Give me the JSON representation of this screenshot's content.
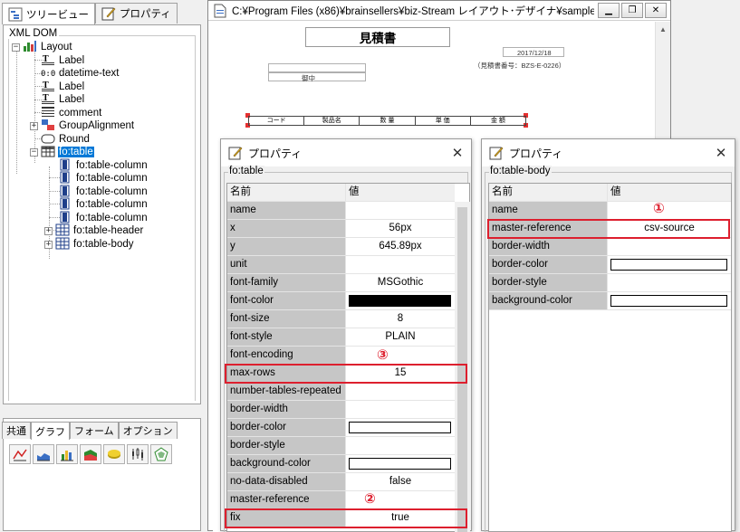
{
  "left_tabs": {
    "tree_label": "ツリービュー",
    "prop_label": "プロパティ"
  },
  "tree": {
    "legend": "XML DOM",
    "nodes": [
      {
        "label": "Layout"
      },
      {
        "label": "Label"
      },
      {
        "label": "datetime-text"
      },
      {
        "label": "Label"
      },
      {
        "label": "Label"
      },
      {
        "label": "comment"
      },
      {
        "label": "GroupAlignment"
      },
      {
        "label": "Round"
      },
      {
        "label": "fo:table"
      },
      {
        "label": "fo:table-column"
      },
      {
        "label": "fo:table-column"
      },
      {
        "label": "fo:table-column"
      },
      {
        "label": "fo:table-column"
      },
      {
        "label": "fo:table-column"
      },
      {
        "label": "fo:table-header"
      },
      {
        "label": "fo:table-body"
      }
    ]
  },
  "palette": {
    "tabs": [
      "共通",
      "グラフ",
      "フォーム",
      "オプション"
    ],
    "icons": [
      "line-chart-icon",
      "area-chart-icon",
      "bar-chart-icon",
      "stacked-area-icon",
      "pie-3d-icon",
      "candle-chart-icon",
      "radar-chart-icon"
    ]
  },
  "designer": {
    "title": "C:¥Program Files (x86)¥brainsellers¥biz-Stream レイアウト･デザイナ¥sample¥...",
    "doc_title": "見積書",
    "doc_date": "2017/12/18",
    "doc_number": "（見積書番号：BZS-E-0226）",
    "honorific": "御中",
    "table_headers": [
      "コード",
      "製品名",
      "数 量",
      "単 価",
      "金 額"
    ]
  },
  "dialog_left": {
    "title": "プロパティ",
    "legend": "fo:table",
    "header_name": "名前",
    "header_value": "値",
    "rows": [
      {
        "name": "name",
        "value": ""
      },
      {
        "name": "x",
        "value": "56px"
      },
      {
        "name": "y",
        "value": "645.89px"
      },
      {
        "name": "unit",
        "value": ""
      },
      {
        "name": "font-family",
        "value": "MSGothic"
      },
      {
        "name": "font-color",
        "value": ""
      },
      {
        "name": "font-size",
        "value": "8"
      },
      {
        "name": "font-style",
        "value": "PLAIN"
      },
      {
        "name": "font-encoding",
        "value": ""
      },
      {
        "name": "max-rows",
        "value": "15"
      },
      {
        "name": "number-tables-repeated",
        "value": ""
      },
      {
        "name": "border-width",
        "value": ""
      },
      {
        "name": "border-color",
        "value": ""
      },
      {
        "name": "border-style",
        "value": ""
      },
      {
        "name": "background-color",
        "value": ""
      },
      {
        "name": "no-data-disabled",
        "value": "false"
      },
      {
        "name": "master-reference",
        "value": ""
      },
      {
        "name": "fix",
        "value": "true"
      }
    ],
    "marks": {
      "max_rows": "③",
      "master_reference": "②"
    }
  },
  "dialog_right": {
    "title": "プロパティ",
    "legend": "fo:table-body",
    "header_name": "名前",
    "header_value": "値",
    "rows": [
      {
        "name": "name",
        "value": ""
      },
      {
        "name": "master-reference",
        "value": "csv-source"
      },
      {
        "name": "border-width",
        "value": ""
      },
      {
        "name": "border-color",
        "value": ""
      },
      {
        "name": "border-style",
        "value": ""
      },
      {
        "name": "background-color",
        "value": ""
      }
    ],
    "marks": {
      "master_reference": "①"
    }
  },
  "colors": {
    "highlight": "#dd1f2e",
    "selection": "#0078d7",
    "key_cell": "#c6c6c6",
    "font_color_swatch": "#000000"
  }
}
